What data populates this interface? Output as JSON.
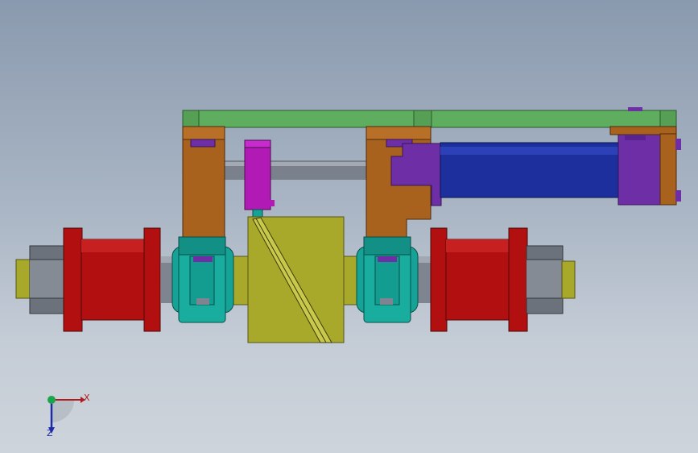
{
  "triad": {
    "x_label": "X",
    "z_label": "Z",
    "x_color": "#b01c1c",
    "z_color": "#1c2ca8",
    "y_color": "#1aa54a"
  },
  "colors": {
    "frame_green": "#5fae5f",
    "bracket_brown": "#a9611e",
    "cylinder_blue": "#1d2f9c",
    "cylinder_caps_purple": "#6e2fa6",
    "sensor_magenta": "#b21ab6",
    "roller_red": "#b21010",
    "bearing_teal": "#16a397",
    "shaft_gray": "#7f8590",
    "cam_olive": "#a8a82a",
    "nut_gray": "#6c727b"
  }
}
